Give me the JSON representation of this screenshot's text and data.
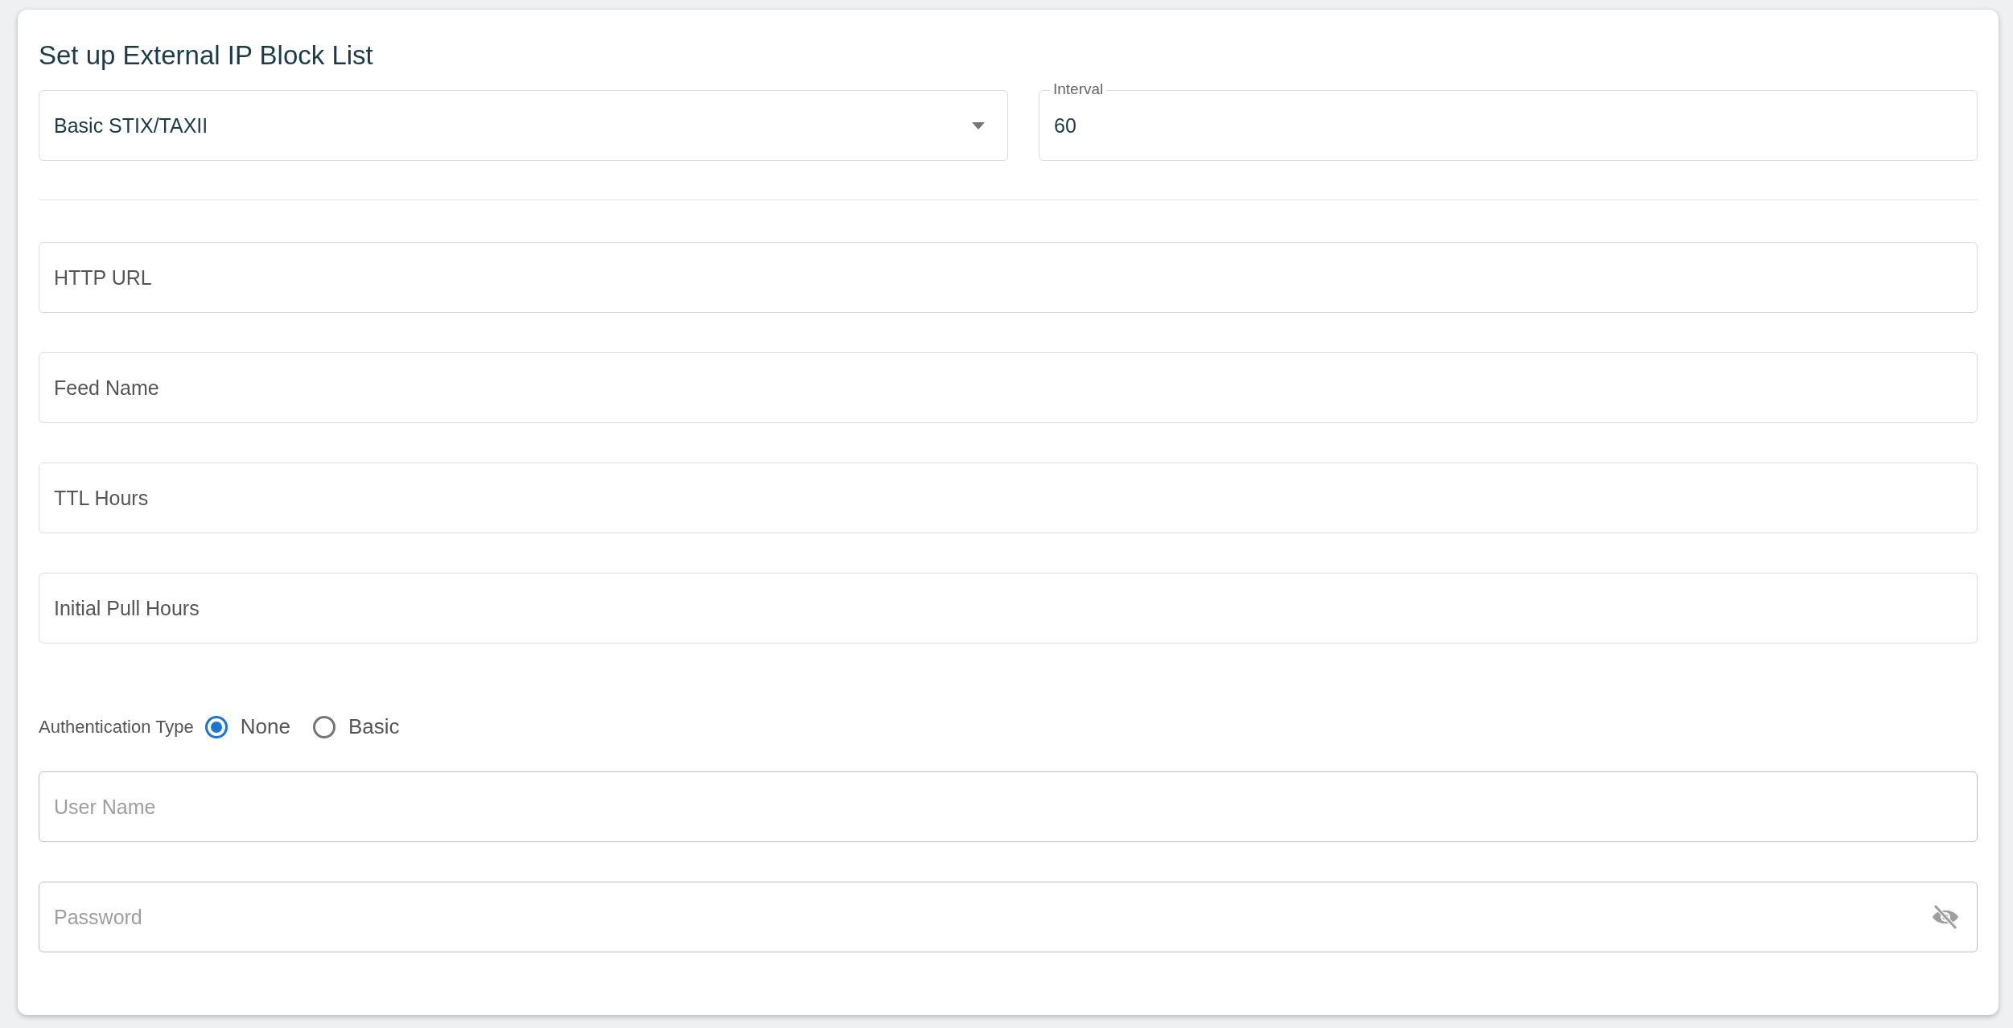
{
  "title": "Set up External IP Block List",
  "source_select": {
    "value": "Basic STIX/TAXII"
  },
  "interval": {
    "label": "Interval",
    "value": "60"
  },
  "feed_fields": [
    {
      "label": "HTTP URL"
    },
    {
      "label": "Feed Name"
    },
    {
      "label": "TTL Hours"
    },
    {
      "label": "Initial Pull Hours"
    }
  ],
  "authentication": {
    "label": "Authentication Type",
    "options": [
      {
        "label": "None",
        "selected": true
      },
      {
        "label": "Basic",
        "selected": false
      }
    ]
  },
  "credential_fields": [
    {
      "kind": "text",
      "placeholder": "User Name"
    },
    {
      "kind": "password",
      "placeholder": "Password"
    }
  ]
}
